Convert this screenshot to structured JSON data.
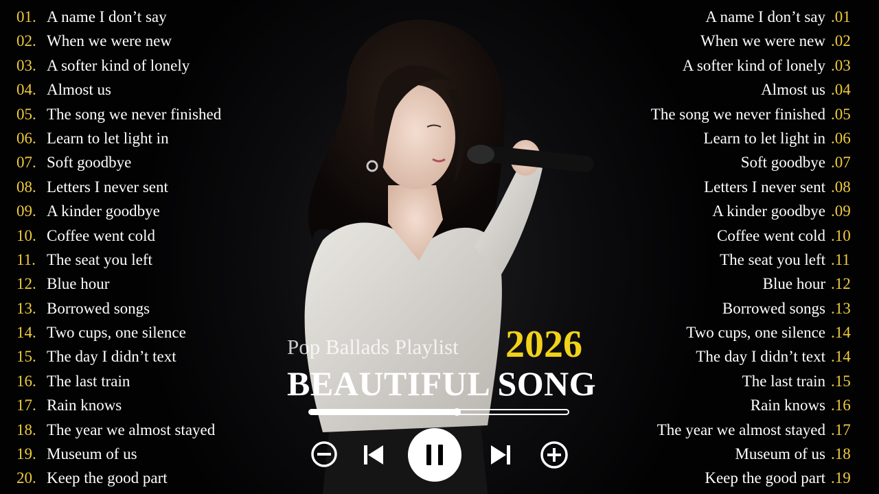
{
  "left_tracks": [
    {
      "num": "01.",
      "title": "A name I don’t say"
    },
    {
      "num": "02.",
      "title": "When we were new"
    },
    {
      "num": "03.",
      "title": "A softer kind of lonely"
    },
    {
      "num": "04.",
      "title": "Almost us"
    },
    {
      "num": "05.",
      "title": "The song we never finished"
    },
    {
      "num": "06.",
      "title": "Learn to let light in"
    },
    {
      "num": "07.",
      "title": "Soft goodbye"
    },
    {
      "num": "08.",
      "title": "Letters I never sent"
    },
    {
      "num": "09.",
      "title": "A kinder goodbye"
    },
    {
      "num": "10.",
      "title": "Coffee went cold"
    },
    {
      "num": "11.",
      "title": "The seat you left"
    },
    {
      "num": "12.",
      "title": "Blue hour"
    },
    {
      "num": "13.",
      "title": "Borrowed songs"
    },
    {
      "num": "14.",
      "title": "Two cups, one silence"
    },
    {
      "num": "15.",
      "title": "The day I didn’t text"
    },
    {
      "num": "16.",
      "title": "The last train"
    },
    {
      "num": "17.",
      "title": "Rain knows"
    },
    {
      "num": "18.",
      "title": "The year we almost stayed"
    },
    {
      "num": "19.",
      "title": "Museum of us"
    },
    {
      "num": "20.",
      "title": "Keep the good part"
    }
  ],
  "right_tracks": [
    {
      "num": ".01",
      "title": "A name I don’t say"
    },
    {
      "num": ".02",
      "title": "When we were new"
    },
    {
      "num": ".03",
      "title": "A softer kind of lonely"
    },
    {
      "num": ".04",
      "title": "Almost us"
    },
    {
      "num": ".05",
      "title": "The song we never finished"
    },
    {
      "num": ".06",
      "title": "Learn to let light in"
    },
    {
      "num": ".07",
      "title": "Soft goodbye"
    },
    {
      "num": ".08",
      "title": "Letters I never sent"
    },
    {
      "num": ".09",
      "title": "A kinder goodbye"
    },
    {
      "num": ".10",
      "title": "Coffee went cold"
    },
    {
      "num": ".11",
      "title": "The seat you left"
    },
    {
      "num": ".12",
      "title": "Blue hour"
    },
    {
      "num": ".13",
      "title": "Borrowed songs"
    },
    {
      "num": ".14",
      "title": "Two cups, one silence"
    },
    {
      "num": ".14",
      "title": "The day I didn’t text"
    },
    {
      "num": ".15",
      "title": "The last train"
    },
    {
      "num": ".16",
      "title": "Rain knows"
    },
    {
      "num": ".17",
      "title": "The year we almost stayed"
    },
    {
      "num": ".18",
      "title": "Museum of us"
    },
    {
      "num": ".19",
      "title": "Keep the good part"
    }
  ],
  "center": {
    "subtitle": "Pop Ballads Playlist",
    "year": "2026",
    "title": "BEAUTIFUL SONG"
  },
  "player": {
    "progress": 0.57,
    "controls": {
      "remove": "minus-circle-icon",
      "previous": "skip-previous-icon",
      "play_pause": "pause-icon",
      "next": "skip-next-icon",
      "add": "plus-circle-icon"
    }
  },
  "colors": {
    "number": "#f0cc3c",
    "year": "#f2d21a",
    "text": "#ffffff",
    "background": "#0c0c0e"
  }
}
